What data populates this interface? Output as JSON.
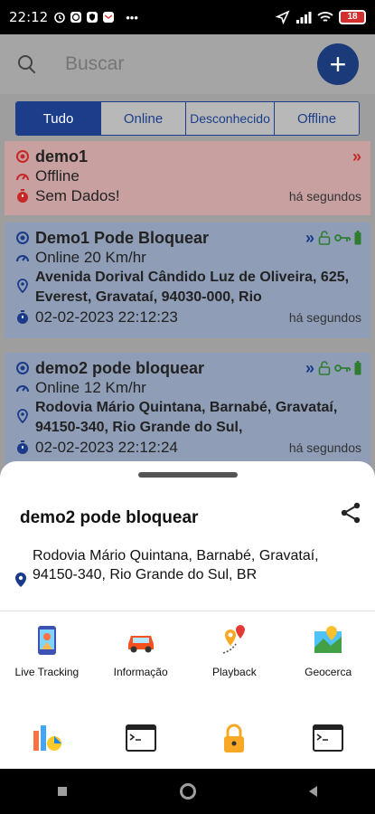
{
  "status_bar": {
    "time": "22:12",
    "icons_left": [
      "alarm-icon",
      "whatsapp-icon",
      "shield-icon",
      "mail-icon"
    ],
    "battery": "18"
  },
  "search": {
    "placeholder": "Buscar"
  },
  "tabs": [
    {
      "label": "Tudo",
      "active": true
    },
    {
      "label": "Online",
      "active": false
    },
    {
      "label": "Desconhecido",
      "active": false
    },
    {
      "label": "Offline",
      "active": false
    }
  ],
  "devices": [
    {
      "name": "demo1",
      "status": "Offline",
      "time": "Sem Dados!",
      "ago": "há segundos"
    },
    {
      "name": "Demo1 Pode Bloquear",
      "status": "Online 20 Km/hr",
      "address": "Avenida Dorival Cândido Luz de Oliveira, 625, Everest, Gravataí, 94030-000, Rio",
      "time": "02-02-2023 22:12:23",
      "ago": "há segundos"
    },
    {
      "name": "demo2 pode bloquear",
      "status": "Online 12 Km/hr",
      "address": "Rodovia Mário Quintana, Barnabé, Gravataí, 94150-340, Rio Grande do Sul,",
      "time": "02-02-2023 22:12:24",
      "ago": "há segundos"
    }
  ],
  "sheet": {
    "title": "demo2 pode bloquear",
    "address": "Rodovia Mário Quintana, Barnabé, Gravataí, 94150-340, Rio Grande do Sul, BR",
    "actions_row1": [
      {
        "label": "Live Tracking",
        "icon": "phone-map-icon"
      },
      {
        "label": "Informação",
        "icon": "car-icon"
      },
      {
        "label": "Playback",
        "icon": "route-pins-icon"
      },
      {
        "label": "Geocerca",
        "icon": "map-icon"
      }
    ],
    "actions_row2": [
      {
        "label": "",
        "icon": "report-chart-icon"
      },
      {
        "label": "",
        "icon": "terminal-icon"
      },
      {
        "label": "",
        "icon": "lock-icon"
      },
      {
        "label": "",
        "icon": "terminal-icon"
      }
    ]
  },
  "colors": {
    "accent": "#1c3e8a",
    "offline_card": "#c9a0a0",
    "online_card": "#8f9db7"
  }
}
